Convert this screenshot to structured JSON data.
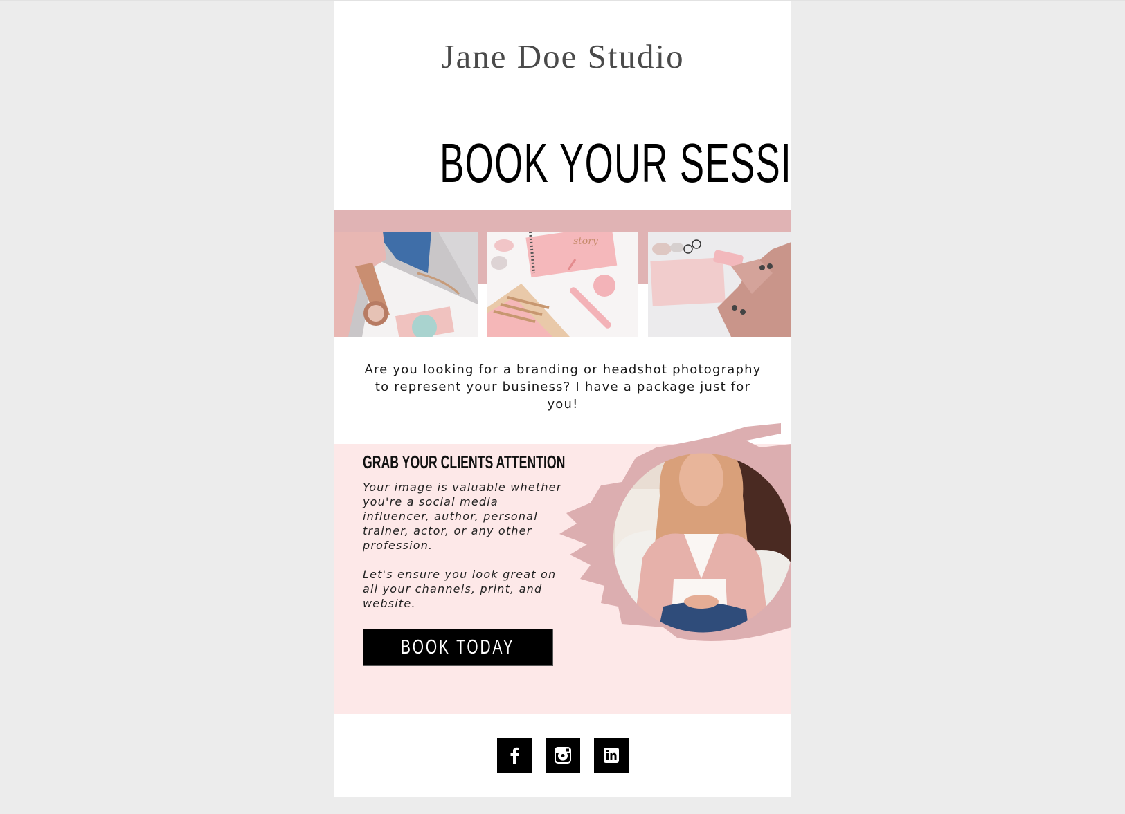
{
  "email": {
    "brand_name": "Jane Doe Studio",
    "headline": "BOOK YOUR SESSION",
    "gallery": [
      {
        "name": "coffee-flatlay-photo",
        "alt": "Woman holding latte on white table"
      },
      {
        "name": "notebook-flatlay-photo",
        "alt": "Pink notebooks, pen and paperclip flatlay"
      },
      {
        "name": "laptop-flatlay-photo",
        "alt": "Woman in pink blazer at laptop"
      }
    ],
    "intro_text": "Are you looking for a branding or headshot photography to represent your business? I have a package just for you!",
    "promo": {
      "title": "GRAB YOUR CLIENTS ATTENTION",
      "paragraphs": [
        "Your image is valuable whether you're a social media influencer, author, personal trainer, actor, or any other profession.",
        "Let's ensure you look great on all your channels, print, and website."
      ],
      "cta_label": "BOOK TODAY",
      "portrait_alt": "Smiling woman in pink cardigan seated in armchair"
    },
    "social": [
      {
        "name": "facebook",
        "icon": "facebook-icon"
      },
      {
        "name": "instagram",
        "icon": "instagram-icon"
      },
      {
        "name": "linkedin",
        "icon": "linkedin-icon"
      }
    ]
  },
  "colors": {
    "page_background": "#ececec",
    "pink_band": "#e0b3b4",
    "promo_background": "#fde8e8",
    "brush_accent": "#dcaeb0",
    "cta_background": "#000000",
    "brand_text": "#4a4a4a"
  }
}
